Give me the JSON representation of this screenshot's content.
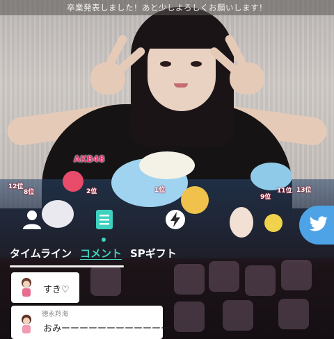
{
  "banner": {
    "text": "卒業発表しました！あと少しよろしくお願いします！"
  },
  "stage": {
    "brand": "AKB48",
    "ranks": [
      "12位",
      "8位",
      "2位",
      "1位",
      "9位",
      "11位",
      "13位"
    ]
  },
  "tabs": [
    {
      "label": "タイムライン",
      "active": false
    },
    {
      "label": "コメント",
      "active": true
    },
    {
      "label": "SPギフト",
      "active": false
    }
  ],
  "nav_icons": [
    "profile-icon",
    "comment-list-icon",
    "lightning-icon"
  ],
  "share": {
    "icon": "twitter-bird-icon",
    "color": "#4ea3e6"
  },
  "comments": [
    {
      "name": "",
      "text": "すき♡"
    },
    {
      "name": "徳永羚海",
      "text": "おみーーーーーーーーーーーー"
    }
  ],
  "colors": {
    "accent": "#3fd1bf",
    "banner_bg": "#5a5654",
    "twitter": "#4ea3e6"
  }
}
